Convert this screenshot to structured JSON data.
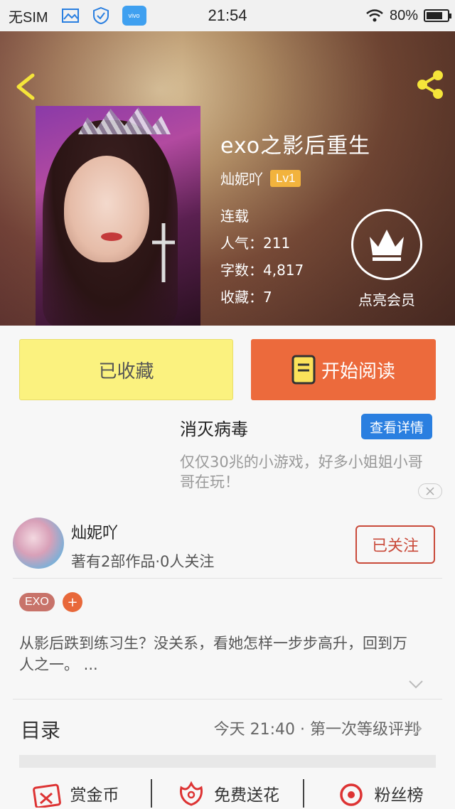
{
  "status_bar": {
    "carrier": "无SIM",
    "time": "21:54",
    "battery": "80%",
    "battery_level": 0.8,
    "app_icon_label": "vivo",
    "icons": [
      "image-icon",
      "shield-icon",
      "app-store-icon",
      "wifi-icon",
      "battery-icon"
    ]
  },
  "book": {
    "title": "exo之影后重生",
    "author": "灿妮吖",
    "level": "Lv1",
    "status": "连载",
    "popularity": "人气：211",
    "word_count": "字数：4,817",
    "favorites": "收藏：7"
  },
  "vip": {
    "label": "点亮会员"
  },
  "actions": {
    "collected": "已收藏",
    "start_reading": "开始阅读"
  },
  "ad": {
    "title": "消灭病毒",
    "button": "查看详情",
    "description": "仅仅30兆的小游戏，好多小姐姐小哥哥在玩！"
  },
  "author_card": {
    "name": "灿妮吖",
    "subtitle": "著有2部作品·0人关注",
    "follow": "已关注"
  },
  "tags": {
    "items": [
      "EXO"
    ],
    "add": "+"
  },
  "synopsis": "从影后跌到练习生？没关系，看她怎样一步步高升，回到万人之一。 ...",
  "catalog": {
    "label": "目录",
    "latest": "今天 21:40 · 第一次等级评判"
  },
  "bottom_actions": [
    {
      "label": "赏金币",
      "icon": "reward-coin-icon"
    },
    {
      "label": "免费送花",
      "icon": "flower-icon"
    },
    {
      "label": "粉丝榜",
      "icon": "fan-rank-icon"
    }
  ],
  "colors": {
    "collected_bg": "#fbf27f",
    "read_bg": "#ec6a3c",
    "follow_border": "#c94a3a",
    "ad_button": "#2a7fe0",
    "level_badge": "#f2b33d"
  }
}
